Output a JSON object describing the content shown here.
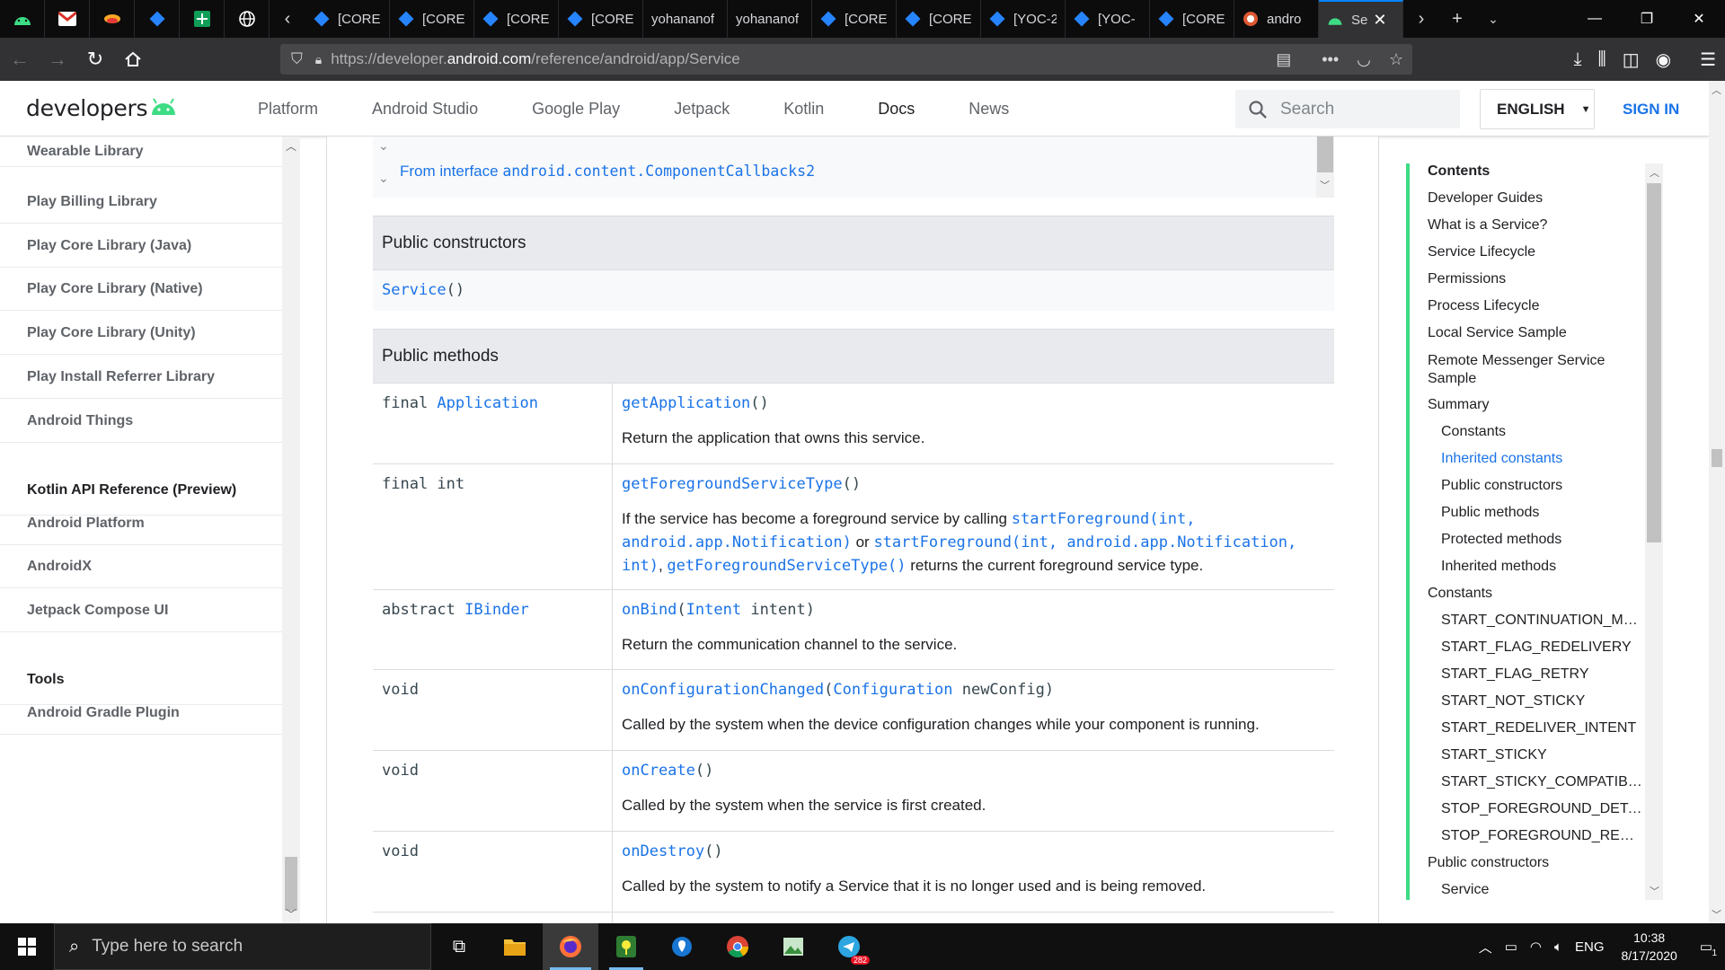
{
  "browser": {
    "tabs": [
      {
        "label": "[CORE",
        "icon": "jira-icon"
      },
      {
        "label": "[CORE",
        "icon": "jira-icon"
      },
      {
        "label": "[CORE",
        "icon": "jira-icon"
      },
      {
        "label": "[CORE",
        "icon": "jira-icon"
      },
      {
        "label": "yohananof",
        "icon": "none"
      },
      {
        "label": "yohananof",
        "icon": "none"
      },
      {
        "label": "[CORE",
        "icon": "jira-icon"
      },
      {
        "label": "[CORE",
        "icon": "jira-icon"
      },
      {
        "label": "[YOC-2",
        "icon": "jira-icon"
      },
      {
        "label": "[YOC-",
        "icon": "jira-icon"
      },
      {
        "label": "[CORE",
        "icon": "jira-icon"
      },
      {
        "label": "andro",
        "icon": "duckduckgo-icon"
      }
    ],
    "active_tab": {
      "label": "Se",
      "icon": "android-icon"
    },
    "url_prefix": "https://developer.",
    "url_host": "android.com",
    "url_path": "/reference/android/app/Service"
  },
  "site": {
    "logo_text": "developers",
    "nav": [
      "Platform",
      "Android Studio",
      "Google Play",
      "Jetpack",
      "Kotlin",
      "Docs",
      "News"
    ],
    "current_nav": "Docs",
    "search_placeholder": "Search",
    "language": "ENGLISH",
    "sign_in": "SIGN IN"
  },
  "leftnav": {
    "items": [
      {
        "label": "Wearable Library",
        "section": false
      },
      {
        "label": "Play Billing Library",
        "section": false
      },
      {
        "label": "Play Core Library (Java)",
        "section": false
      },
      {
        "label": "Play Core Library (Native)",
        "section": false
      },
      {
        "label": "Play Core Library (Unity)",
        "section": false
      },
      {
        "label": "Play Install Referrer Library",
        "section": false
      },
      {
        "label": "Android Things",
        "section": false
      },
      {
        "label": "Kotlin API Reference (Preview)",
        "section": true
      },
      {
        "label": "Android Platform",
        "section": false
      },
      {
        "label": "AndroidX",
        "section": false
      },
      {
        "label": "Jetpack Compose UI",
        "section": false
      },
      {
        "label": "Tools",
        "section": true
      },
      {
        "label": "Android Gradle Plugin",
        "section": false
      }
    ]
  },
  "main": {
    "inherit_prefix": "From interface ",
    "inherit_link": "android.content.ComponentCallbacks2",
    "constructors_header": "Public constructors",
    "constructor_name": "Service",
    "constructor_parens": "()",
    "methods_header": "Public methods",
    "methods": [
      {
        "mod": "final ",
        "type": "Application",
        "type_link": true,
        "name": "getApplication",
        "params": "()",
        "desc": "Return the application that owns this service."
      },
      {
        "mod": "final int",
        "type": "",
        "type_link": false,
        "name": "getForegroundServiceType",
        "params": "()",
        "desc": ""
      },
      {
        "mod": "abstract ",
        "type": "IBinder",
        "type_link": true,
        "name": "onBind",
        "params_open": "(",
        "param_type": "Intent",
        "param_name": " intent)",
        "desc": "Return the communication channel to the service."
      },
      {
        "mod": "void",
        "type": "",
        "type_link": false,
        "name": "onConfigurationChanged",
        "params_open": "(",
        "param_type": "Configuration",
        "param_name": " newConfig)",
        "desc": "Called by the system when the device configuration changes while your component is running."
      },
      {
        "mod": "void",
        "type": "",
        "type_link": false,
        "name": "onCreate",
        "params": "()",
        "desc": "Called by the system when the service is first created."
      },
      {
        "mod": "void",
        "type": "",
        "type_link": false,
        "name": "onDestroy",
        "params": "()",
        "desc": "Called by the system to notify a Service that it is no longer used and is being removed."
      }
    ],
    "fg_desc": {
      "p1": "If the service has become a foreground service by calling ",
      "l1": "startForeground(int, android.app.Notification)",
      "p2": " or ",
      "l2": "startForeground(int, android.app.Notification, int)",
      "p3": ", ",
      "l3": "getForegroundServiceType()",
      "p4": " returns the current foreground service type."
    }
  },
  "toc": {
    "items": [
      {
        "label": "Contents",
        "level": 1,
        "title": true,
        "active": false
      },
      {
        "label": "Developer Guides",
        "level": 1,
        "title": false,
        "active": false
      },
      {
        "label": "What is a Service?",
        "level": 1,
        "title": false,
        "active": false
      },
      {
        "label": "Service Lifecycle",
        "level": 1,
        "title": false,
        "active": false
      },
      {
        "label": "Permissions",
        "level": 1,
        "title": false,
        "active": false
      },
      {
        "label": "Process Lifecycle",
        "level": 1,
        "title": false,
        "active": false
      },
      {
        "label": "Local Service Sample",
        "level": 1,
        "title": false,
        "active": false
      },
      {
        "label": "Remote Messenger Service Sample",
        "level": 1,
        "title": false,
        "active": false
      },
      {
        "label": "Summary",
        "level": 1,
        "title": false,
        "active": false
      },
      {
        "label": "Constants",
        "level": 2,
        "title": false,
        "active": false
      },
      {
        "label": "Inherited constants",
        "level": 2,
        "title": false,
        "active": true
      },
      {
        "label": "Public constructors",
        "level": 2,
        "title": false,
        "active": false
      },
      {
        "label": "Public methods",
        "level": 2,
        "title": false,
        "active": false
      },
      {
        "label": "Protected methods",
        "level": 2,
        "title": false,
        "active": false
      },
      {
        "label": "Inherited methods",
        "level": 2,
        "title": false,
        "active": false
      },
      {
        "label": "Constants",
        "level": 1,
        "title": false,
        "active": false
      },
      {
        "label": "START_CONTINUATION_MA…",
        "level": 2,
        "title": false,
        "active": false
      },
      {
        "label": "START_FLAG_REDELIVERY",
        "level": 2,
        "title": false,
        "active": false
      },
      {
        "label": "START_FLAG_RETRY",
        "level": 2,
        "title": false,
        "active": false
      },
      {
        "label": "START_NOT_STICKY",
        "level": 2,
        "title": false,
        "active": false
      },
      {
        "label": "START_REDELIVER_INTENT",
        "level": 2,
        "title": false,
        "active": false
      },
      {
        "label": "START_STICKY",
        "level": 2,
        "title": false,
        "active": false
      },
      {
        "label": "START_STICKY_COMPATIBI…",
        "level": 2,
        "title": false,
        "active": false
      },
      {
        "label": "STOP_FOREGROUND_DETA…",
        "level": 2,
        "title": false,
        "active": false
      },
      {
        "label": "STOP_FOREGROUND_REMO…",
        "level": 2,
        "title": false,
        "active": false
      },
      {
        "label": "Public constructors",
        "level": 1,
        "title": false,
        "active": false
      },
      {
        "label": "Service",
        "level": 2,
        "title": false,
        "active": false
      }
    ]
  },
  "taskbar": {
    "search_placeholder": "Type here to search",
    "lang": "ENG",
    "time": "10:38",
    "date": "8/17/2020",
    "telegram_badge": "282",
    "notif_count": "1"
  },
  "colors": {
    "accent": "#1a73e8",
    "android_green": "#3ddc84"
  }
}
